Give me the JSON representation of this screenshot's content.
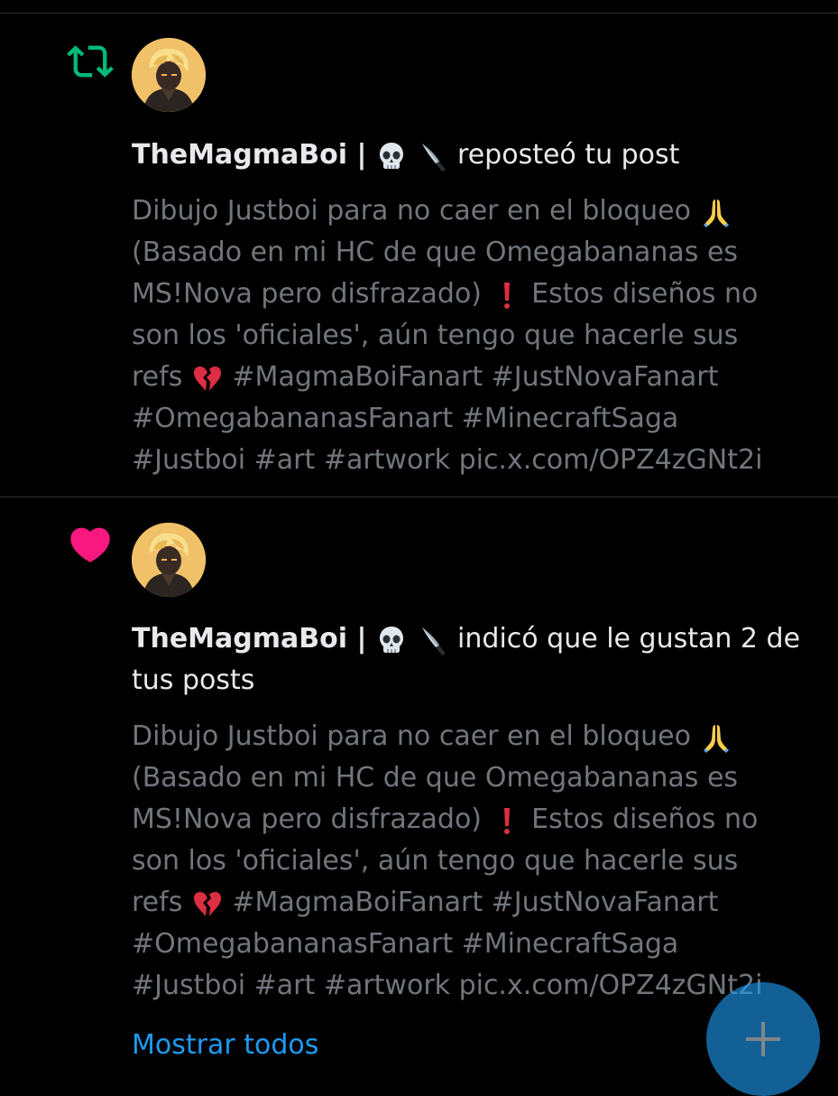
{
  "notifications": [
    {
      "type": "repost",
      "icon": "repost-icon",
      "icon_color": "#00ba7c",
      "actor_name": "TheMagmaBoi |",
      "actor_emojis": [
        "skull-emoji",
        "knife-emoji"
      ],
      "action_text": "reposteó tu post",
      "post_text": {
        "line1": "Dibujo Justboi para no caer en el bloqueo",
        "line2": "(Basado en mi HC de que Omegabananas es",
        "line3a": "MS!Nova pero disfrazado)",
        "line3b": "Estos diseños no",
        "line4": "son los 'oficiales', aún tengo que hacerle sus",
        "line5a": "refs",
        "line5b": "#MagmaBoiFanart #JustNovaFanart",
        "line6": "#OmegabananasFanart #MinecraftSaga",
        "line7": "#Justboi #art #artwork pic.x.com/OPZ4zGNt2i"
      }
    },
    {
      "type": "like",
      "icon": "heart-icon",
      "icon_color": "#f91880",
      "actor_name": "TheMagmaBoi |",
      "actor_emojis": [
        "skull-emoji",
        "knife-emoji"
      ],
      "action_text": "indicó que le gustan 2 de tus posts",
      "post_text": {
        "line1": "Dibujo Justboi para no caer en el bloqueo",
        "line2": "(Basado en mi HC de que Omegabananas es",
        "line3a": "MS!Nova pero disfrazado)",
        "line3b": "Estos diseños no",
        "line4": "son los 'oficiales', aún tengo que hacerle sus",
        "line5a": "refs",
        "line5b": "#MagmaBoiFanart #JustNovaFanart",
        "line6": "#OmegabananasFanart #MinecraftSaga",
        "line7": "#Justboi #art #artwork pic.x.com/OPZ4zGNt2i"
      }
    }
  ],
  "show_all_label": "Mostrar todos",
  "fab": {
    "icon": "plus-icon"
  },
  "colors": {
    "background": "#000000",
    "primary_text": "#e7e9ea",
    "secondary_text": "#71767b",
    "accent": "#1d9bf0"
  }
}
